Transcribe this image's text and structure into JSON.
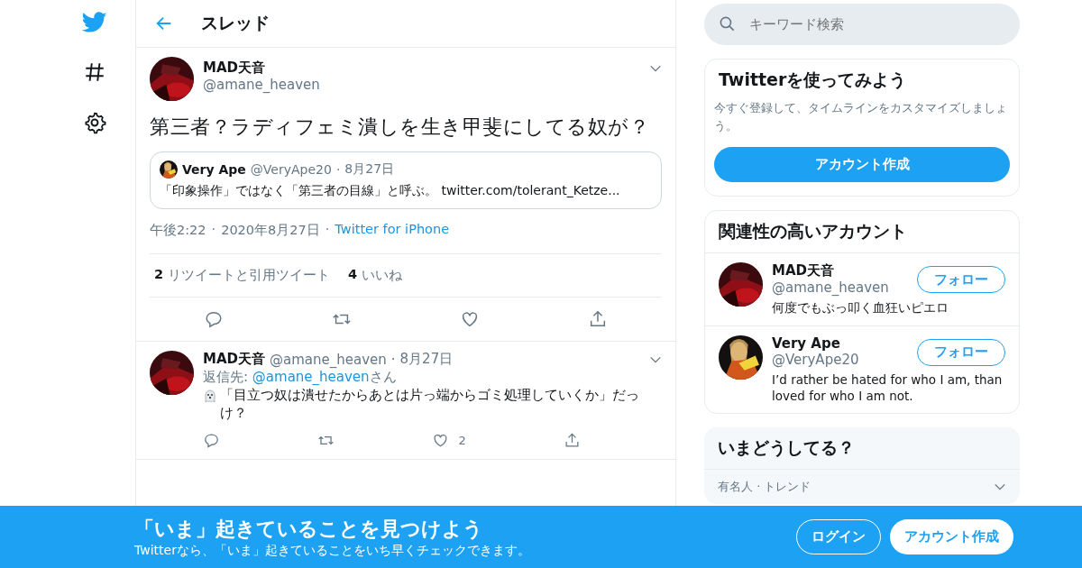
{
  "header": {
    "title": "スレッド"
  },
  "separator": "·",
  "search": {
    "placeholder": "キーワード検索"
  },
  "tweet": {
    "name": "MAD天音",
    "handle": "@amane_heaven",
    "text": "第三者？ラディフェミ潰しを生き甲斐にしてる奴が？",
    "quote": {
      "name": "Very Ape",
      "handle": "@VeryApe20",
      "date": "8月27日",
      "text": "「印象操作」ではなく「第三者の目線」と呼ぶ。 twitter.com/tolerant_Ketze..."
    },
    "time": "午後2:22",
    "date": "2020年8月27日",
    "source": "Twitter for iPhone",
    "stats": [
      {
        "count": "2",
        "label": "リツイートと引用ツイート"
      },
      {
        "count": "4",
        "label": "いいね"
      }
    ]
  },
  "reply": {
    "name": "MAD天音",
    "handle": "@amane_heaven",
    "date": "8月27日",
    "reply_prefix": "返信先: ",
    "reply_to": "@amane_heaven",
    "reply_suffix": "さん",
    "text": "「目立つ奴は潰せたからあとは片っ端からゴミ処理していくか」だっけ？",
    "like_count": "2"
  },
  "signup_card": {
    "title": "Twitterを使ってみよう",
    "text": "今すぐ登録して、タイムラインをカスタマイズしましょう。",
    "button": "アカウント作成"
  },
  "related": {
    "title": "関連性の高いアカウント",
    "accounts": [
      {
        "name": "MAD天音",
        "handle": "@amane_heaven",
        "bio": "何度でもぶっ叩く血狂いピエロ",
        "button": "フォロー"
      },
      {
        "name": "Very Ape",
        "handle": "@VeryApe20",
        "bio": "I’d rather be hated for who I am, than loved for who I am not.",
        "button": "フォロー"
      }
    ]
  },
  "trends": {
    "title": "いまどうしてる？",
    "items": [
      {
        "context": "有名人 · トレンド"
      }
    ]
  },
  "banner": {
    "title": "「いま」起きていることを見つけよう",
    "subtitle": "Twitterなら、「いま」起きていることをいち早くチェックできます。",
    "login": "ログイン",
    "signup": "アカウント作成"
  }
}
